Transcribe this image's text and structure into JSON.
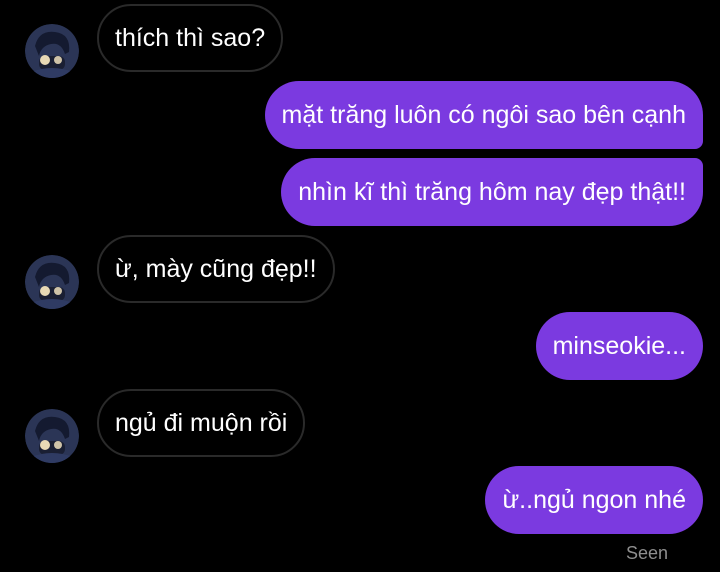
{
  "colors": {
    "background": "#000000",
    "sent_bubble": "#7b3ae0",
    "received_border": "#2a2a2a",
    "seen_text": "#8e8e8e"
  },
  "messages": [
    {
      "from": "them",
      "text": "thích thì sao?"
    },
    {
      "from": "me",
      "text": "mặt trăng luôn có ngôi sao bên cạnh"
    },
    {
      "from": "me",
      "text": "nhìn kĩ thì trăng hôm nay đẹp thật!!"
    },
    {
      "from": "them",
      "text": "ừ, mày cũng đẹp!!"
    },
    {
      "from": "me",
      "text": "minseokie..."
    },
    {
      "from": "them",
      "text": "ngủ đi muộn rồi"
    },
    {
      "from": "me",
      "text": "ừ..ngủ ngon nhé"
    }
  ],
  "status": {
    "seen": "Seen"
  }
}
